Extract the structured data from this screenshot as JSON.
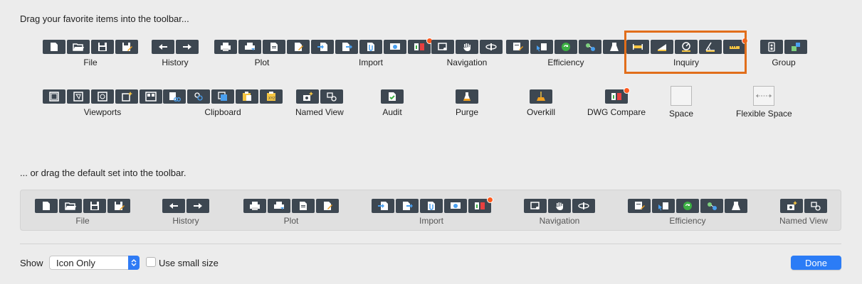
{
  "headings": {
    "favorites": "Drag your favorite items into the toolbar...",
    "defaults": "... or drag the default set into the toolbar."
  },
  "favorite_groups": {
    "file": "File",
    "history": "History",
    "plot": "Plot",
    "import": "Import",
    "navigation": "Navigation",
    "efficiency": "Efficiency",
    "inquiry": "Inquiry",
    "group": "Group",
    "viewports": "Viewports",
    "clipboard": "Clipboard",
    "named_view": "Named View",
    "audit": "Audit",
    "purge": "Purge",
    "overkill": "Overkill",
    "dwg_compare": "DWG Compare",
    "space": "Space",
    "flexible_space": "Flexible Space"
  },
  "default_set": {
    "file": "File",
    "history": "History",
    "plot": "Plot",
    "import": "Import",
    "navigation": "Navigation",
    "efficiency": "Efficiency",
    "named_view": "Named View"
  },
  "footer": {
    "show_label": "Show",
    "show_value": "Icon Only",
    "small_size_label": "Use small size",
    "small_size_checked": false,
    "done_label": "Done"
  },
  "colors": {
    "icon_bg": "#3d4751",
    "badge": "#ff5a1f",
    "highlight": "#e16e1b",
    "accent": "#2b7cf6"
  }
}
